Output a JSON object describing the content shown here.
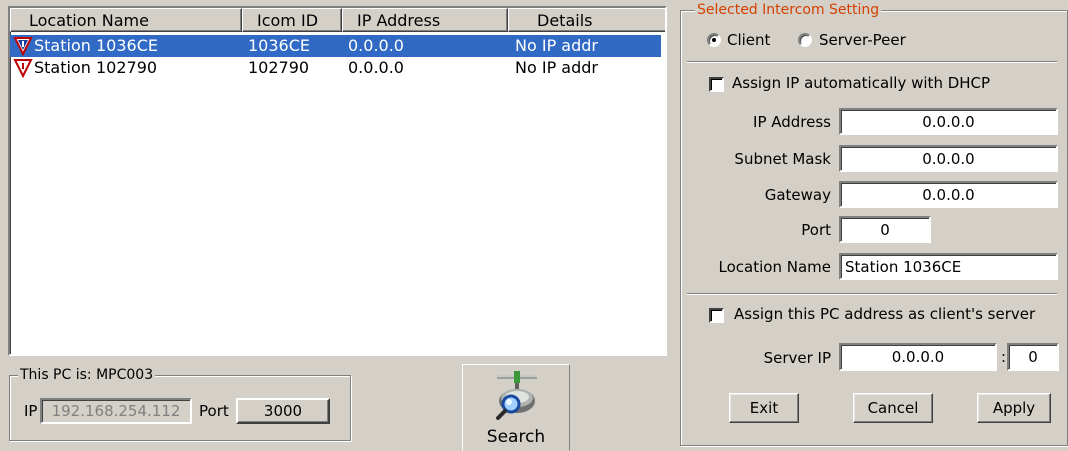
{
  "station_list": {
    "columns": [
      "Location Name",
      "Icom ID",
      "IP Address",
      "Details"
    ],
    "rows": [
      {
        "name": "Station 1036CE",
        "icom_id": "1036CE",
        "ip": "0.0.0.0",
        "details": "No IP addr",
        "selected": true,
        "icon": "station-tamper-icon"
      },
      {
        "name": "Station 102790",
        "icom_id": "102790",
        "ip": "0.0.0.0",
        "details": "No IP addr",
        "selected": false,
        "icon": "station-tamper-icon"
      }
    ]
  },
  "this_pc": {
    "title": "This PC is: MPC003",
    "ip_label": "IP",
    "ip_value": "192.168.254.112",
    "port_label": "Port",
    "port_value": "3000"
  },
  "search": {
    "label": "Search",
    "icon": "network-search-icon"
  },
  "settings": {
    "title": "Selected Intercom Setting",
    "title_color": "#d44000",
    "mode_client": "Client",
    "mode_server_peer": "Server-Peer",
    "mode_selected": "Client",
    "dhcp_label": "Assign IP automatically with  DHCP",
    "dhcp_checked": false,
    "ip_label": "IP Address",
    "ip_value": "0.0.0.0",
    "subnet_label": "Subnet Mask",
    "subnet_value": "0.0.0.0",
    "gateway_label": "Gateway",
    "gateway_value": "0.0.0.0",
    "port_label": "Port",
    "port_value": "0",
    "location_label": "Location Name",
    "location_value": "Station 1036CE",
    "assign_server_label": "Assign this PC address as client's server",
    "assign_server_checked": false,
    "server_ip_label": "Server IP",
    "server_ip_value": "0.0.0.0",
    "server_port_sep": ":",
    "server_port_value": "0"
  },
  "buttons": {
    "exit": "Exit",
    "cancel": "Cancel",
    "apply": "Apply"
  },
  "colors": {
    "selection": "#316ac5",
    "window_bg": "#d4d0c8"
  }
}
